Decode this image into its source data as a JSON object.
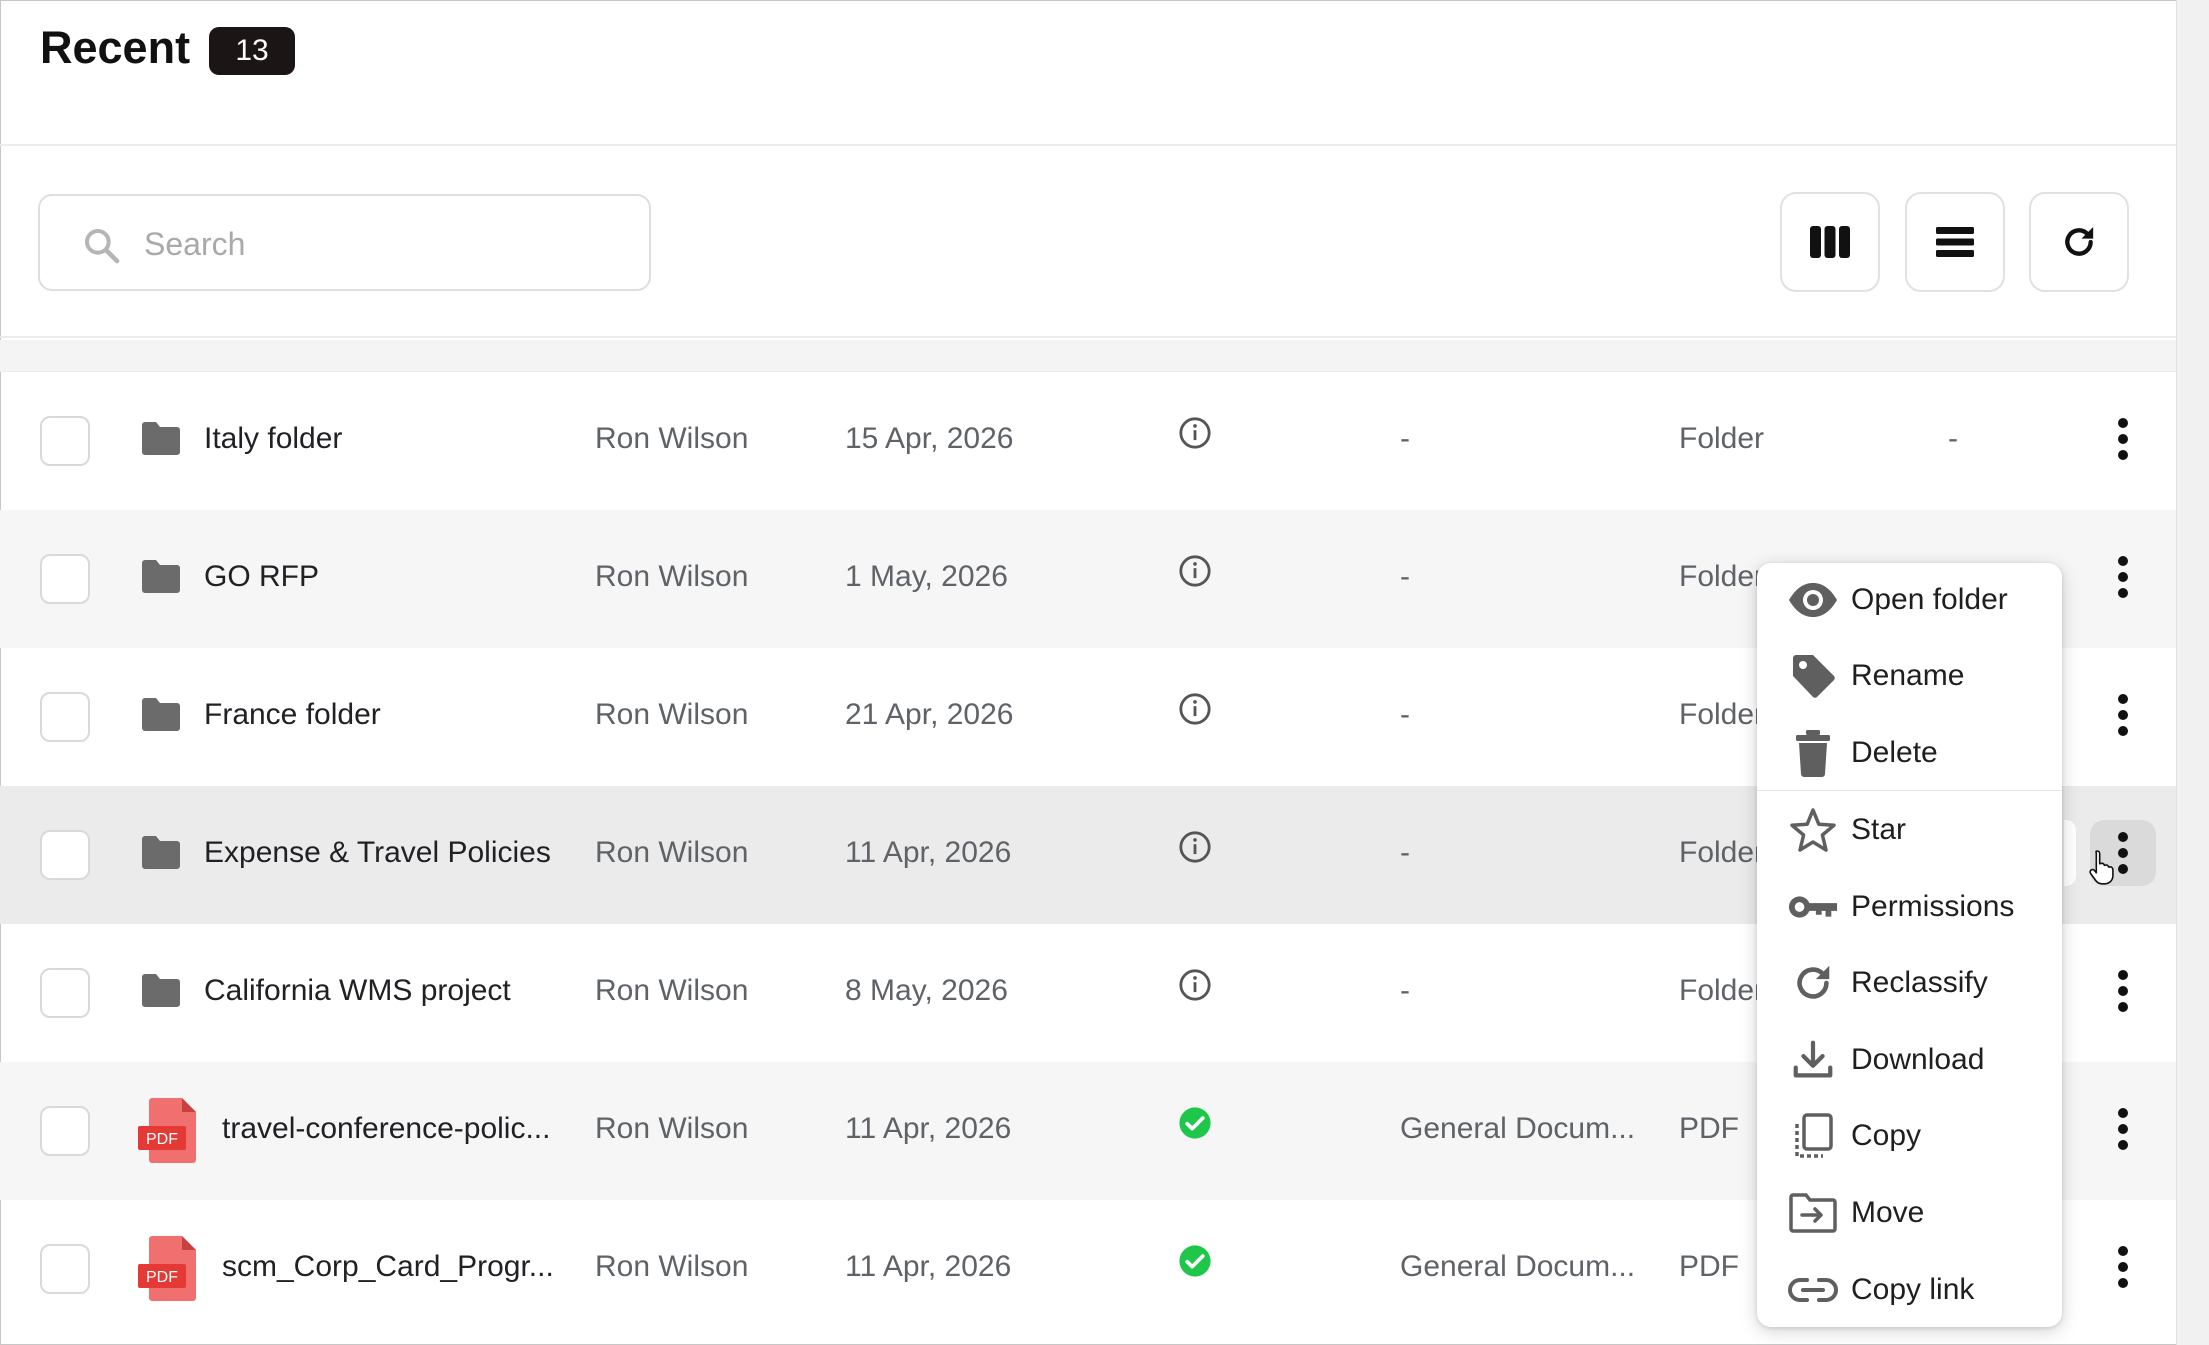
{
  "header": {
    "title": "Recent",
    "count": "13"
  },
  "search": {
    "placeholder": "Search"
  },
  "toolbar": {
    "icons": [
      "columns-view-icon",
      "list-view-icon",
      "refresh-icon"
    ]
  },
  "rows": [
    {
      "kind": "folder",
      "name": "Italy folder",
      "owner": "Ron Wilson",
      "date": "15 Apr, 2026",
      "status": "info",
      "classification": "-",
      "type": "Folder",
      "size": "-"
    },
    {
      "kind": "folder",
      "name": "GO RFP",
      "owner": "Ron Wilson",
      "date": "1 May, 2026",
      "status": "info",
      "classification": "-",
      "type": "Folder"
    },
    {
      "kind": "folder",
      "name": "France folder",
      "owner": "Ron Wilson",
      "date": "21 Apr, 2026",
      "status": "info",
      "classification": "-",
      "type": "Folder"
    },
    {
      "kind": "folder",
      "name": "Expense & Travel Policies",
      "owner": "Ron Wilson",
      "date": "11 Apr, 2026",
      "status": "info",
      "classification": "-",
      "type": "Folder"
    },
    {
      "kind": "folder",
      "name": "California WMS project",
      "owner": "Ron Wilson",
      "date": "8 May, 2026",
      "status": "info",
      "classification": "-",
      "type": "Folder"
    },
    {
      "kind": "pdf",
      "badge": "PDF",
      "name": "travel-conference-polic...",
      "owner": "Ron Wilson",
      "date": "11 Apr, 2026",
      "status": "classified",
      "classification": "General Docum...",
      "type": "PDF"
    },
    {
      "kind": "pdf",
      "badge": "PDF",
      "name": "scm_Corp_Card_Progr...",
      "owner": "Ron Wilson",
      "date": "11 Apr, 2026",
      "status": "classified",
      "classification": "General Docum...",
      "type": "PDF"
    }
  ],
  "context_menu": {
    "items": [
      {
        "label": "Open folder",
        "icon": "eye-icon"
      },
      {
        "label": "Rename",
        "icon": "tag-icon"
      },
      {
        "label": "Delete",
        "icon": "trash-icon"
      },
      {
        "label": "Star",
        "icon": "star-icon"
      },
      {
        "label": "Permissions",
        "icon": "key-icon"
      },
      {
        "label": "Reclassify",
        "icon": "reclassify-icon"
      },
      {
        "label": "Download",
        "icon": "download-icon"
      },
      {
        "label": "Copy",
        "icon": "copy-icon"
      },
      {
        "label": "Move",
        "icon": "move-icon"
      },
      {
        "label": "Copy link",
        "icon": "link-icon"
      }
    ]
  },
  "colors": {
    "badge_bg": "#1b1615",
    "folder_icon": "#6b6b6b",
    "pdf_red": "#e53935",
    "check_green": "#1ec74a",
    "row_alt": "#f6f6f6",
    "row_hover": "#ebebeb"
  }
}
